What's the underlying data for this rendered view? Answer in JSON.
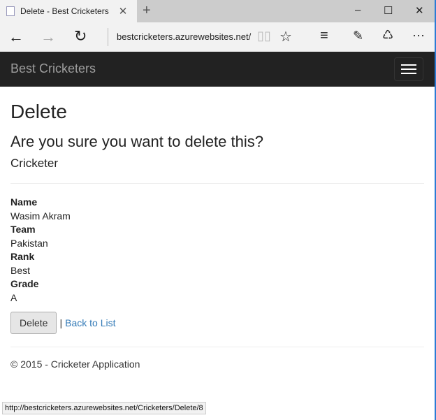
{
  "browser": {
    "tab_title": "Delete - Best Cricketers",
    "url": "bestcricketers.azurewebsites.net/",
    "status_url": "http://bestcricketers.azurewebsites.net/Cricketers/Delete/8"
  },
  "navbar": {
    "brand": "Best Cricketers"
  },
  "page": {
    "title": "Delete",
    "question": "Are you sure you want to delete this?",
    "entity": "Cricketer",
    "fields": [
      {
        "label": "Name",
        "value": "Wasim Akram"
      },
      {
        "label": "Team",
        "value": "Pakistan"
      },
      {
        "label": "Rank",
        "value": "Best"
      },
      {
        "label": "Grade",
        "value": "A"
      }
    ],
    "delete_label": "Delete",
    "separator": "|",
    "back_label": "Back to List"
  },
  "footer": {
    "text": "© 2015 - Cricketer Application"
  }
}
